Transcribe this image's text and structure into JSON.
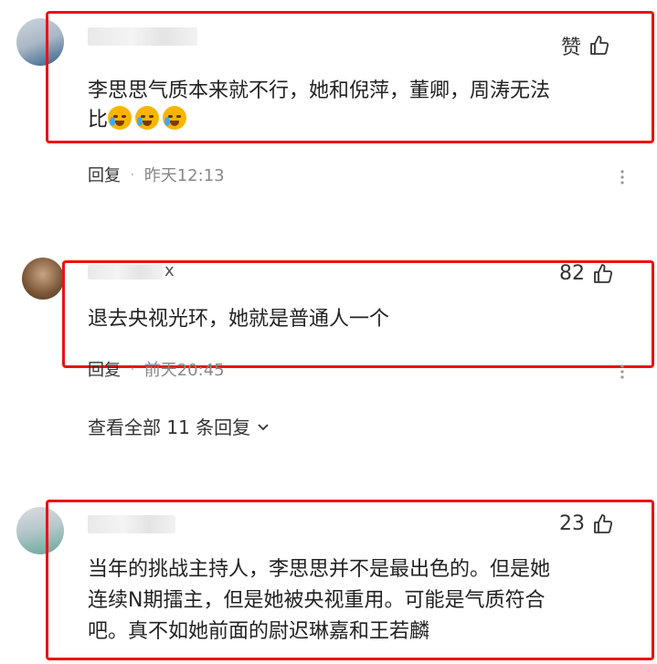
{
  "comments": [
    {
      "like_label": "赞",
      "content_line1": "李思思气质本来就不行，她和倪萍，董卿，周涛无法",
      "content_line2": "比",
      "emoji_names": [
        "crying-laugh-emoji",
        "crying-laugh-emoji",
        "crying-laugh-emoji"
      ],
      "reply_label": "回复",
      "separator": "·",
      "time": "昨天12:13"
    },
    {
      "name_suffix": "x",
      "likes": "82",
      "content": "退去央视光环，她就是普通人一个",
      "reply_label": "回复",
      "separator": "·",
      "time": "前天20:45",
      "view_all": "查看全部 11 条回复"
    },
    {
      "likes": "23",
      "content_line1": "当年的挑战主持人，李思思并不是最出色的。但是她",
      "content_line2": "连续N期擂主，但是她被央视重用。可能是气质符合",
      "content_line3": "吧。真不如她前面的尉迟琳嘉和王若麟"
    }
  ],
  "colors": {
    "highlight_box": "#e11111",
    "emoji": "#f7b500"
  },
  "icons": [
    "thumbs-up-icon",
    "more-icon",
    "chevron-down-icon"
  ]
}
